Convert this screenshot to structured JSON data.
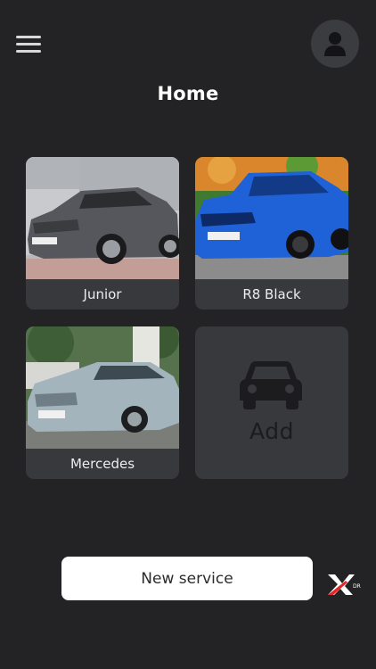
{
  "header": {
    "title": "Home"
  },
  "cars": [
    {
      "name": "Junior",
      "body_color": "#5a5c61",
      "background": "#c9cbcf"
    },
    {
      "name": "R8 Black",
      "body_color": "#1d5fd6",
      "background": "#e7ad4b"
    },
    {
      "name": "Mercedes",
      "body_color": "#9fb2bb",
      "background": "#4d6a4a"
    }
  ],
  "add_card": {
    "label": "Add",
    "icon": "car-icon"
  },
  "actions": {
    "new_service_label": "New service"
  },
  "icons": {
    "menu": "hamburger-menu-icon",
    "profile": "user-icon",
    "brand": "xd-logo"
  },
  "colors": {
    "background": "#232325",
    "card": "#38393d",
    "accent": "#e32626"
  }
}
